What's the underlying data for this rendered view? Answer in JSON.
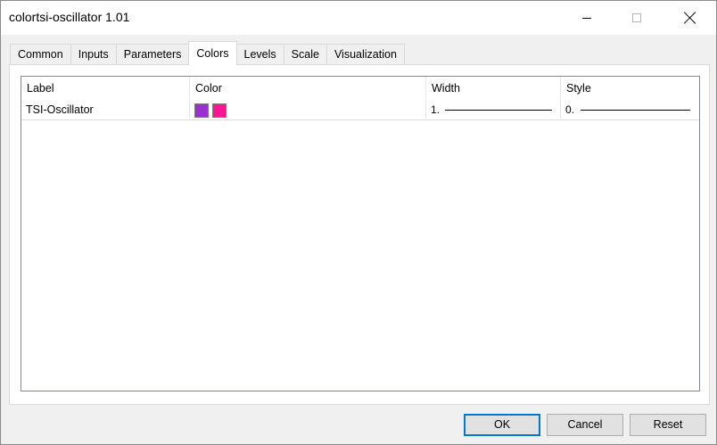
{
  "window": {
    "title": "colortsi-oscillator 1.01"
  },
  "tabs": [
    {
      "label": "Common"
    },
    {
      "label": "Inputs"
    },
    {
      "label": "Parameters"
    },
    {
      "label": "Colors",
      "active": true
    },
    {
      "label": "Levels"
    },
    {
      "label": "Scale"
    },
    {
      "label": "Visualization"
    }
  ],
  "table": {
    "headers": {
      "label": "Label",
      "color": "Color",
      "width": "Width",
      "style": "Style"
    },
    "rows": [
      {
        "label": "TSI-Oscillator",
        "colors": [
          "#9b30d0",
          "#ff1493"
        ],
        "width": "1.",
        "style": "0."
      }
    ]
  },
  "buttons": {
    "ok": "OK",
    "cancel": "Cancel",
    "reset": "Reset"
  },
  "theme": {
    "accent": "#0078d7"
  }
}
